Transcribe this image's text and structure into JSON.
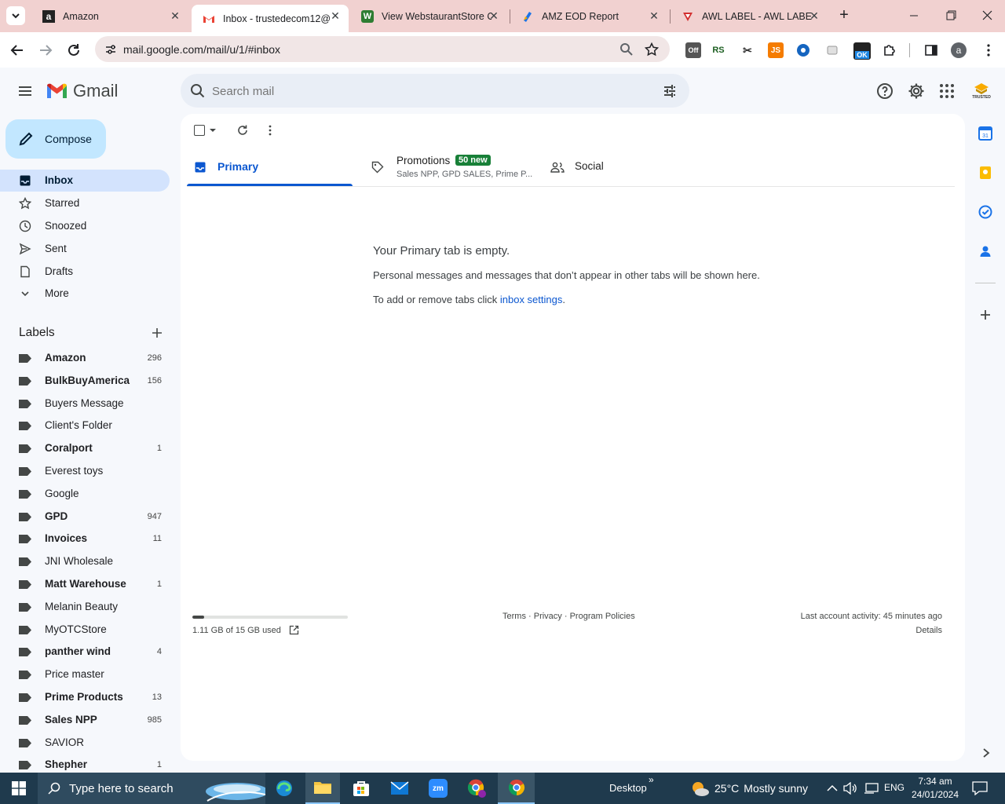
{
  "browser": {
    "tabs": [
      {
        "title": "Amazon",
        "active": false
      },
      {
        "title": "Inbox - trustedecom12@",
        "active": true
      },
      {
        "title": "View WebstaurantStore O",
        "active": false
      },
      {
        "title": "AMZ EOD Report",
        "active": false
      },
      {
        "title": "AWL LABEL - AWL LABEL",
        "active": false
      }
    ],
    "url": "mail.google.com/mail/u/1/#inbox",
    "extensions": [
      {
        "name": "off-extension-icon",
        "text": "Off"
      },
      {
        "name": "rs-extension-icon",
        "text": "RS"
      },
      {
        "name": "js-extension-icon",
        "text": "JS"
      },
      {
        "name": "ok-extension-icon",
        "text": "OK"
      }
    ],
    "profile_initial": "a",
    "accent_color": "#f1d1d0"
  },
  "gmail": {
    "logo_text": "Gmail",
    "search_placeholder": "Search mail",
    "compose_label": "Compose",
    "account_badge_text": "TRUSTED",
    "nav": [
      {
        "label": "Inbox",
        "icon": "inbox-icon",
        "selected": true
      },
      {
        "label": "Starred",
        "icon": "star-icon",
        "selected": false
      },
      {
        "label": "Snoozed",
        "icon": "clock-icon",
        "selected": false
      },
      {
        "label": "Sent",
        "icon": "send-icon",
        "selected": false
      },
      {
        "label": "Drafts",
        "icon": "draft-icon",
        "selected": false
      },
      {
        "label": "More",
        "icon": "chevron-down-icon",
        "selected": false
      }
    ],
    "labels_heading": "Labels",
    "labels": [
      {
        "name": "Amazon",
        "count": "296",
        "bold": true
      },
      {
        "name": "BulkBuyAmerica",
        "count": "156",
        "bold": true
      },
      {
        "name": "Buyers Message",
        "count": "",
        "bold": false
      },
      {
        "name": "Client's Folder",
        "count": "",
        "bold": false
      },
      {
        "name": "Coralport",
        "count": "1",
        "bold": true
      },
      {
        "name": "Everest toys",
        "count": "",
        "bold": false
      },
      {
        "name": "Google",
        "count": "",
        "bold": false
      },
      {
        "name": "GPD",
        "count": "947",
        "bold": true
      },
      {
        "name": "Invoices",
        "count": "11",
        "bold": true
      },
      {
        "name": "JNI Wholesale",
        "count": "",
        "bold": false
      },
      {
        "name": "Matt Warehouse",
        "count": "1",
        "bold": true
      },
      {
        "name": "Melanin Beauty",
        "count": "",
        "bold": false
      },
      {
        "name": "MyOTCStore",
        "count": "",
        "bold": false
      },
      {
        "name": "panther wind",
        "count": "4",
        "bold": true
      },
      {
        "name": "Price master",
        "count": "",
        "bold": false
      },
      {
        "name": "Prime Products",
        "count": "13",
        "bold": true
      },
      {
        "name": "Sales NPP",
        "count": "985",
        "bold": true
      },
      {
        "name": "SAVIOR",
        "count": "",
        "bold": false
      },
      {
        "name": "Shepher",
        "count": "1",
        "bold": true
      }
    ],
    "tabs": {
      "primary": "Primary",
      "promotions": "Promotions",
      "promotions_badge": "50 new",
      "promotions_sub": "Sales NPP, GPD SALES, Prime P...",
      "social": "Social"
    },
    "empty": {
      "title": "Your Primary tab is empty.",
      "line1": "Personal messages and messages that don’t appear in other tabs will be shown here.",
      "line2_prefix": "To add or remove tabs click ",
      "line2_link": "inbox settings",
      "line2_suffix": "."
    },
    "footer": {
      "storage": "1.11 GB of 15 GB used",
      "storage_fraction": 0.074,
      "terms": "Terms",
      "sep1": " · ",
      "privacy": "Privacy",
      "sep2": " · ",
      "policies": "Program Policies",
      "activity": "Last account activity: 45 minutes ago",
      "details": "Details"
    }
  },
  "taskbar": {
    "search_placeholder": "Type here to search",
    "desktop_label": "Desktop",
    "weather_temp": "25°C",
    "weather_desc": "Mostly sunny",
    "lang": "ENG",
    "time": "7:34 am",
    "date": "24/01/2024"
  }
}
